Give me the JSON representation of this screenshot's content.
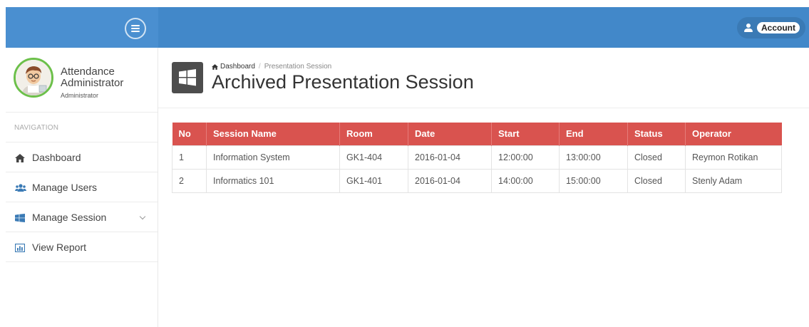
{
  "header": {
    "account_label": "Account"
  },
  "profile": {
    "name": "Attendance Administrator",
    "role": "Administrator"
  },
  "sidebar": {
    "heading": "NAVIGATION",
    "items": [
      {
        "label": "Dashboard",
        "icon": "home-icon"
      },
      {
        "label": "Manage Users",
        "icon": "users-icon"
      },
      {
        "label": "Manage Session",
        "icon": "windows-icon",
        "has_submenu": true
      },
      {
        "label": "View Report",
        "icon": "bar-chart-icon"
      }
    ]
  },
  "breadcrumb": {
    "home": "Dashboard",
    "current": "Presentation Session"
  },
  "page": {
    "title": "Archived Presentation Session"
  },
  "table": {
    "columns": [
      "No",
      "Session Name",
      "Room",
      "Date",
      "Start",
      "End",
      "Status",
      "Operator"
    ],
    "rows": [
      [
        "1",
        "Information System",
        "GK1-404",
        "2016-01-04",
        "12:00:00",
        "13:00:00",
        "Closed",
        "Reymon Rotikan"
      ],
      [
        "2",
        "Informatics 101",
        "GK1-401",
        "2016-01-04",
        "14:00:00",
        "15:00:00",
        "Closed",
        "Stenly Adam"
      ]
    ]
  },
  "colors": {
    "topbar": "#4288c9",
    "table_header": "#d9534f",
    "avatar_ring": "#6cc04a"
  }
}
